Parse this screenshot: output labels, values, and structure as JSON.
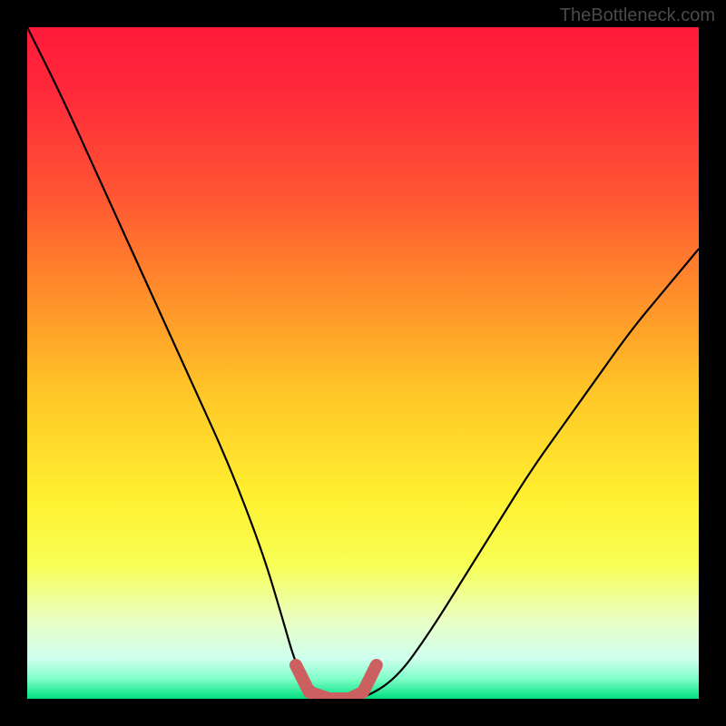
{
  "watermark": "TheBottleneck.com",
  "chart_data": {
    "type": "line",
    "title": "",
    "xlabel": "",
    "ylabel": "",
    "xlim": [
      0,
      100
    ],
    "ylim": [
      0,
      100
    ],
    "series": [
      {
        "name": "bottleneck-curve",
        "x": [
          0,
          5,
          10,
          15,
          20,
          25,
          30,
          35,
          38,
          40,
          42,
          45,
          48,
          50,
          55,
          60,
          65,
          70,
          75,
          80,
          85,
          90,
          95,
          100
        ],
        "y": [
          100,
          90,
          79,
          68,
          57,
          46,
          35,
          22,
          12,
          5,
          2,
          0,
          0,
          0,
          3,
          10,
          18,
          26,
          34,
          41,
          48,
          55,
          61,
          67
        ],
        "color": "#000000"
      },
      {
        "name": "optimal-zone",
        "x": [
          40,
          42,
          45,
          48,
          50,
          52
        ],
        "y": [
          5,
          1,
          0,
          0,
          1,
          5
        ],
        "color": "#cc6060"
      }
    ],
    "gradient_stops": [
      {
        "offset": 0.0,
        "color": "#ff1a3a"
      },
      {
        "offset": 0.1,
        "color": "#ff2a3a"
      },
      {
        "offset": 0.25,
        "color": "#ff5533"
      },
      {
        "offset": 0.4,
        "color": "#ff8f2a"
      },
      {
        "offset": 0.55,
        "color": "#ffc828"
      },
      {
        "offset": 0.7,
        "color": "#fff030"
      },
      {
        "offset": 0.8,
        "color": "#f8ff55"
      },
      {
        "offset": 0.88,
        "color": "#eaffc0"
      },
      {
        "offset": 0.94,
        "color": "#d0ffef"
      },
      {
        "offset": 0.97,
        "color": "#80ffc8"
      },
      {
        "offset": 1.0,
        "color": "#00e080"
      }
    ]
  }
}
